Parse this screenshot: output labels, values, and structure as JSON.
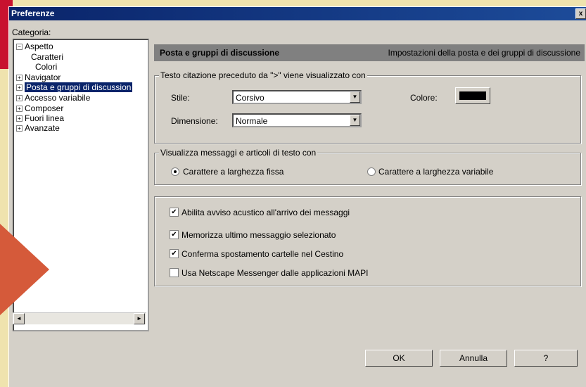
{
  "window": {
    "title": "Preferenze",
    "close_label": "x"
  },
  "category_label": "Categoria:",
  "tree": {
    "items": [
      {
        "label": "Aspetto",
        "expander": "−"
      },
      {
        "label": "Caratteri"
      },
      {
        "label": "Colori"
      },
      {
        "label": "Navigator",
        "expander": "+"
      },
      {
        "label": "Posta e gruppi di discussion",
        "expander": "+"
      },
      {
        "label": "Accesso variabile",
        "expander": "+"
      },
      {
        "label": "Composer",
        "expander": "+"
      },
      {
        "label": "Fuori linea",
        "expander": "+"
      },
      {
        "label": "Avanzate",
        "expander": "+"
      }
    ],
    "scroll_left": "◄",
    "scroll_right": "►"
  },
  "header": {
    "title": "Posta e gruppi di discussione",
    "description": "Impostazioni della posta e dei gruppi di discussione"
  },
  "quote_group": {
    "legend": "Testo citazione preceduto da \">\" viene visualizzato con",
    "style_label": "Stile:",
    "style_value": "Corsivo",
    "size_label": "Dimensione:",
    "size_value": "Normale",
    "color_label": "Colore:",
    "color_value": "#000000",
    "dropdown_arrow": "▼"
  },
  "display_group": {
    "legend": "Visualizza messaggi e articoli di testo con",
    "fixed_label": "Carattere a larghezza fissa",
    "variable_label": "Carattere a larghezza variabile",
    "selected": "fixed"
  },
  "options": [
    {
      "label": "Abilita avviso acustico all'arrivo dei messaggi",
      "checked": true
    },
    {
      "label": "Memorizza ultimo messaggio selezionato",
      "checked": true
    },
    {
      "label": "Conferma spostamento cartelle nel Cestino",
      "checked": true
    },
    {
      "label": "Usa Netscape Messenger dalle applicazioni MAPI",
      "checked": false
    }
  ],
  "check_mark": "✔",
  "buttons": {
    "ok": "OK",
    "cancel": "Annulla",
    "help": "?"
  }
}
